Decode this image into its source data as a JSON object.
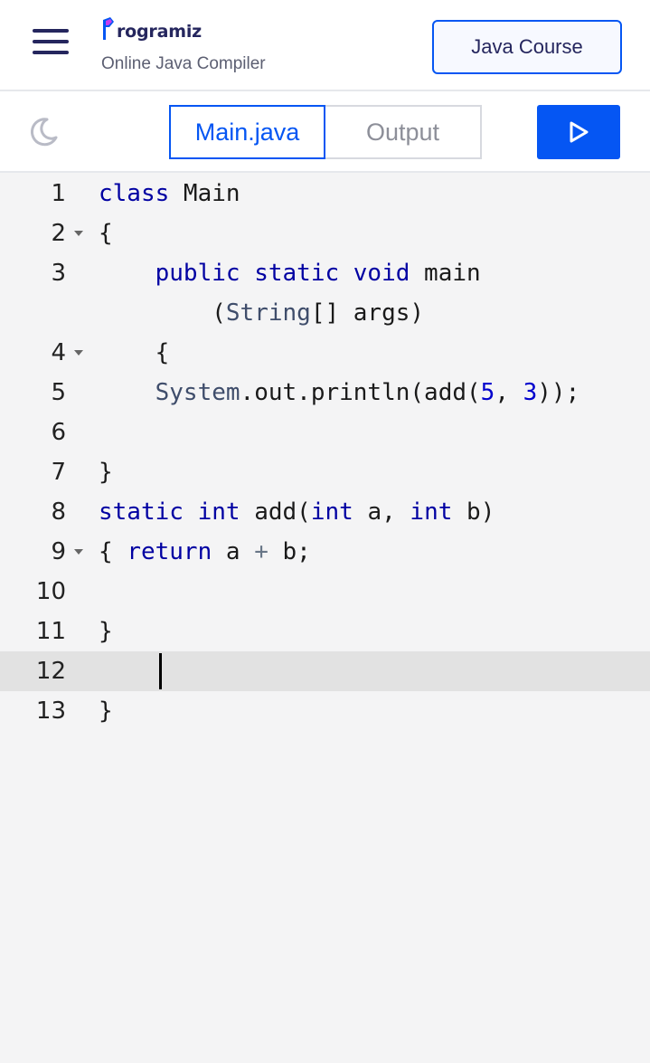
{
  "header": {
    "logo_text": "rogramiz",
    "subtitle": "Online Java Compiler",
    "course_button": "Java Course"
  },
  "toolbar": {
    "tabs": [
      {
        "label": "Main.java",
        "active": true
      },
      {
        "label": "Output",
        "active": false
      }
    ],
    "run_icon": "play-icon",
    "theme_icon": "moon-icon"
  },
  "colors": {
    "accent": "#0556f3",
    "brand_dark": "#25265e",
    "keyword": "#0000a2",
    "number": "#0000cd",
    "active_line": "#e2e2e2"
  },
  "editor": {
    "language": "java",
    "active_line": 12,
    "lines": [
      {
        "number": "1",
        "fold": false,
        "tokens": [
          [
            "kw",
            "class"
          ],
          [
            "pl",
            " Main"
          ]
        ]
      },
      {
        "number": "2",
        "fold": true,
        "tokens": [
          [
            "pl",
            "{"
          ]
        ]
      },
      {
        "number": "3",
        "fold": false,
        "tokens": [
          [
            "pl",
            "    "
          ],
          [
            "kw",
            "public"
          ],
          [
            "pl",
            " "
          ],
          [
            "kw",
            "static"
          ],
          [
            "pl",
            " "
          ],
          [
            "kw",
            "void"
          ],
          [
            "pl",
            " main"
          ]
        ]
      },
      {
        "number": "",
        "fold": false,
        "tokens": [
          [
            "pl",
            "        ("
          ],
          [
            "ty",
            "String"
          ],
          [
            "pl",
            "[] args)"
          ]
        ]
      },
      {
        "number": "4",
        "fold": true,
        "tokens": [
          [
            "pl",
            "    {"
          ]
        ]
      },
      {
        "number": "5",
        "fold": false,
        "tokens": [
          [
            "pl",
            "    "
          ],
          [
            "ty",
            "System"
          ],
          [
            "pl",
            ".out.println(add("
          ],
          [
            "num",
            "5"
          ],
          [
            "pl",
            ", "
          ],
          [
            "num",
            "3"
          ],
          [
            "pl",
            "));"
          ]
        ]
      },
      {
        "number": "6",
        "fold": false,
        "tokens": []
      },
      {
        "number": "7",
        "fold": false,
        "tokens": [
          [
            "pl",
            "}"
          ]
        ]
      },
      {
        "number": "8",
        "fold": false,
        "tokens": [
          [
            "kw",
            "static"
          ],
          [
            "pl",
            " "
          ],
          [
            "kw",
            "int"
          ],
          [
            "pl",
            " add("
          ],
          [
            "kw",
            "int"
          ],
          [
            "pl",
            " a, "
          ],
          [
            "kw",
            "int"
          ],
          [
            "pl",
            " b)"
          ]
        ]
      },
      {
        "number": "9",
        "fold": true,
        "tokens": [
          [
            "pl",
            "{ "
          ],
          [
            "kw",
            "return"
          ],
          [
            "pl",
            " a "
          ],
          [
            "op",
            "+"
          ],
          [
            "pl",
            " b;"
          ]
        ]
      },
      {
        "number": "10",
        "fold": false,
        "tokens": []
      },
      {
        "number": "11",
        "fold": false,
        "tokens": [
          [
            "pl",
            "}"
          ]
        ]
      },
      {
        "number": "12",
        "fold": false,
        "tokens": []
      },
      {
        "number": "13",
        "fold": false,
        "tokens": [
          [
            "pl",
            "}"
          ]
        ]
      }
    ]
  }
}
